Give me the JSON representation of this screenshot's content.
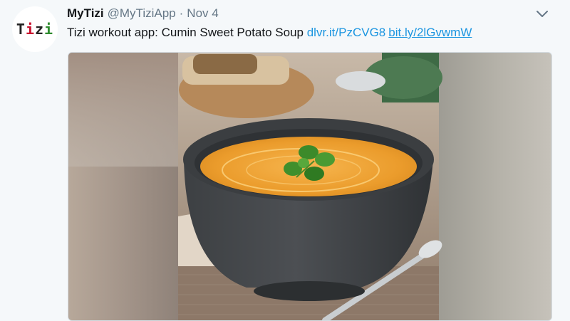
{
  "tweet": {
    "avatar": {
      "t1": "T",
      "i1": "i",
      "z": "z",
      "i2": "i"
    },
    "name": "MyTizi",
    "handle": "@MyTiziApp",
    "separator": "·",
    "time": "Nov 4",
    "text": "Tizi workout app: Cumin Sweet Potato Soup",
    "links": [
      "dlvr.it/PzCVG8",
      "bit.ly/2lGvwmW"
    ],
    "media": {
      "description_icon": "photo"
    }
  },
  "colors": {
    "link": "#1b95e0",
    "avatar_t": "#222222",
    "avatar_i1": "#c8102e",
    "avatar_z": "#222222",
    "avatar_i2": "#2e8b2e",
    "secondary_text": "#657786"
  }
}
